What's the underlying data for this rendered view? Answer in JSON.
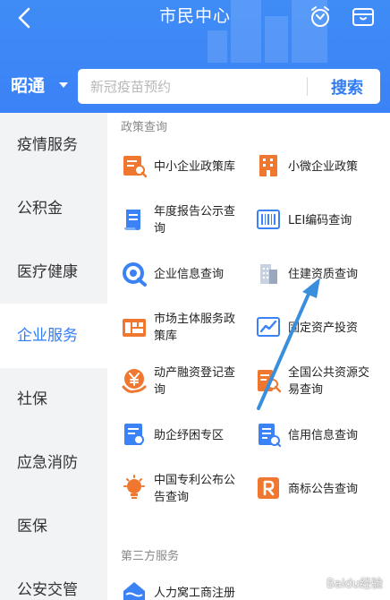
{
  "header": {
    "title": "市民中心",
    "back_icon": "back-arrow-icon",
    "right_icons": [
      "timer-icon",
      "wallet-icon"
    ]
  },
  "search": {
    "city": "昭通",
    "placeholder": "新冠疫苗预约",
    "button": "搜索"
  },
  "sidebar": {
    "items": [
      {
        "label": "疫情服务"
      },
      {
        "label": "公积金"
      },
      {
        "label": "医疗健康"
      },
      {
        "label": "企业服务"
      },
      {
        "label": "社保"
      },
      {
        "label": "应急消防"
      },
      {
        "label": "医保"
      },
      {
        "label": "公安交管"
      }
    ],
    "active_index": 3
  },
  "main": {
    "section1": {
      "title": "政策查询",
      "items": [
        {
          "label": "中小企业政策库",
          "icon": "policy-search-icon",
          "color": "#f0772f"
        },
        {
          "label": "小微企业政策",
          "icon": "building-icon",
          "color": "#f0772f"
        },
        {
          "label": "年度报告公示查询",
          "icon": "report-scroll-icon",
          "color": "#3b82f6"
        },
        {
          "label": "LEI编码查询",
          "icon": "barcode-icon",
          "color": "#3b82f6"
        },
        {
          "label": "企业信息查询",
          "icon": "enterprise-search-icon",
          "color": "#3b82f6"
        },
        {
          "label": "住建资质查询",
          "icon": "city-building-icon",
          "color": "#9aa7bd"
        },
        {
          "label": "市场主体服务政策库",
          "icon": "market-entity-icon",
          "color": "#f0772f"
        },
        {
          "label": "固定资产投资",
          "icon": "trend-chart-icon",
          "color": "#3b82f6"
        },
        {
          "label": "动产融资登记查询",
          "icon": "yen-finance-icon",
          "color": "#f0772f"
        },
        {
          "label": "全国公共资源交易查询",
          "icon": "resource-search-icon",
          "color": "#f0772f"
        },
        {
          "label": "助企纾困专区",
          "icon": "support-doc-icon",
          "color": "#3b82f6"
        },
        {
          "label": "信用信息查询",
          "icon": "credit-doc-icon",
          "color": "#3b82f6"
        },
        {
          "label": "中国专利公布公告查询",
          "icon": "lightbulb-icon",
          "color": "#f0772f"
        },
        {
          "label": "商标公告查询",
          "icon": "trademark-r-icon",
          "color": "#f0772f"
        }
      ]
    },
    "section2": {
      "title": "第三方服务",
      "items": [
        {
          "label": "人力窝工商注册",
          "icon": "house-icon",
          "color": "#3b82f6"
        }
      ]
    }
  },
  "watermark": "Baidu经验",
  "colors": {
    "primary": "#3b82f6",
    "accent": "#2f7cf4",
    "orange": "#f0772f",
    "sidebar_bg": "#f2f3f5"
  }
}
